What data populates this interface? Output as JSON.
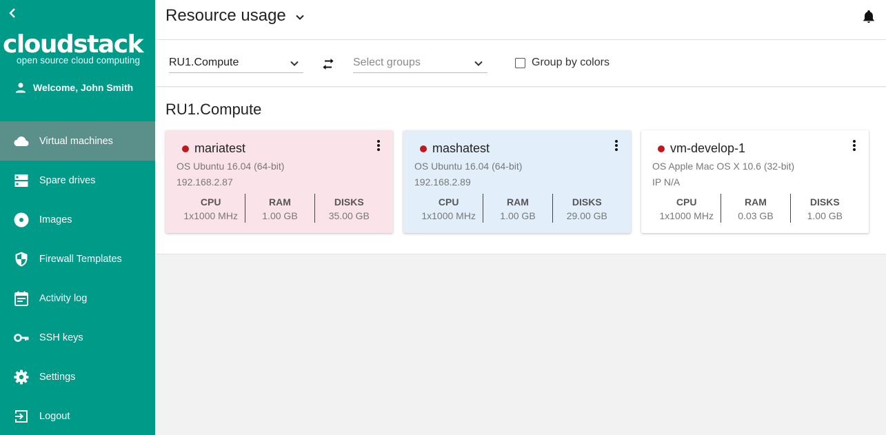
{
  "sidebar": {
    "logo": "cloudstack",
    "logo_sub": "open source cloud computing",
    "welcome": "Welcome, John Smith",
    "items": [
      {
        "label": "Virtual machines",
        "icon": "cloud-icon",
        "active": true
      },
      {
        "label": "Spare drives",
        "icon": "storage-icon"
      },
      {
        "label": "Images",
        "icon": "disc-icon"
      },
      {
        "label": "Firewall Templates",
        "icon": "shield-icon"
      },
      {
        "label": "Activity log",
        "icon": "event-note-icon"
      },
      {
        "label": "SSH keys",
        "icon": "key-icon"
      },
      {
        "label": "Settings",
        "icon": "gear-icon"
      },
      {
        "label": "Logout",
        "icon": "exit-icon"
      }
    ]
  },
  "header": {
    "title": "Resource usage"
  },
  "filters": {
    "zone": "RU1.Compute",
    "groups_placeholder": "Select groups",
    "group_by_colors": "Group by colors"
  },
  "group": {
    "title": "RU1.Compute"
  },
  "vms": [
    {
      "name": "mariatest",
      "os": "OS Ubuntu 16.04 (64-bit)",
      "ip": "192.168.2.87",
      "color": "#fbe3ea",
      "status_color": "#c0161d",
      "stats": [
        {
          "k": "CPU",
          "v": "1x1000 MHz"
        },
        {
          "k": "RAM",
          "v": "1.00 GB"
        },
        {
          "k": "DISKS",
          "v": "35.00 GB"
        }
      ]
    },
    {
      "name": "mashatest",
      "os": "OS Ubuntu 16.04 (64-bit)",
      "ip": "192.168.2.89",
      "color": "#e2effa",
      "status_color": "#c0161d",
      "stats": [
        {
          "k": "CPU",
          "v": "1x1000 MHz"
        },
        {
          "k": "RAM",
          "v": "1.00 GB"
        },
        {
          "k": "DISKS",
          "v": "29.00 GB"
        }
      ]
    },
    {
      "name": "vm-develop-1",
      "os": "OS Apple Mac OS X 10.6 (32-bit)",
      "ip": "IP N/A",
      "color": "#ffffff",
      "status_color": "#c0161d",
      "stats": [
        {
          "k": "CPU",
          "v": "1x1000 MHz"
        },
        {
          "k": "RAM",
          "v": "0.03 GB"
        },
        {
          "k": "DISKS",
          "v": "1.00 GB"
        }
      ]
    }
  ],
  "colors": {
    "sidebar_bg": "#009a89",
    "sidebar_active": "#5b8f89",
    "status_stopped": "#c0161d"
  }
}
